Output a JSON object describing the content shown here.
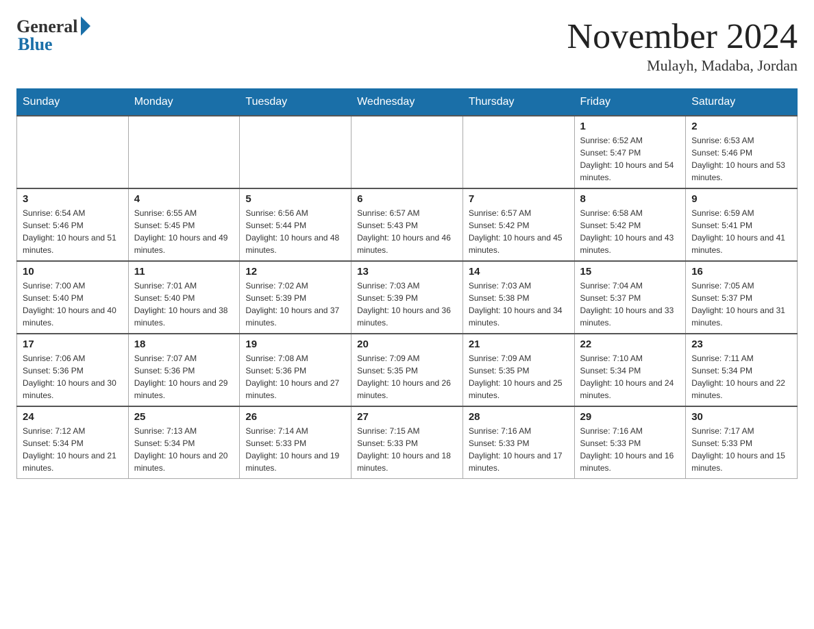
{
  "header": {
    "logo_general": "General",
    "logo_blue": "Blue",
    "month_title": "November 2024",
    "location": "Mulayh, Madaba, Jordan"
  },
  "days_of_week": [
    "Sunday",
    "Monday",
    "Tuesday",
    "Wednesday",
    "Thursday",
    "Friday",
    "Saturday"
  ],
  "weeks": [
    [
      {
        "day": "",
        "info": ""
      },
      {
        "day": "",
        "info": ""
      },
      {
        "day": "",
        "info": ""
      },
      {
        "day": "",
        "info": ""
      },
      {
        "day": "",
        "info": ""
      },
      {
        "day": "1",
        "info": "Sunrise: 6:52 AM\nSunset: 5:47 PM\nDaylight: 10 hours and 54 minutes."
      },
      {
        "day": "2",
        "info": "Sunrise: 6:53 AM\nSunset: 5:46 PM\nDaylight: 10 hours and 53 minutes."
      }
    ],
    [
      {
        "day": "3",
        "info": "Sunrise: 6:54 AM\nSunset: 5:46 PM\nDaylight: 10 hours and 51 minutes."
      },
      {
        "day": "4",
        "info": "Sunrise: 6:55 AM\nSunset: 5:45 PM\nDaylight: 10 hours and 49 minutes."
      },
      {
        "day": "5",
        "info": "Sunrise: 6:56 AM\nSunset: 5:44 PM\nDaylight: 10 hours and 48 minutes."
      },
      {
        "day": "6",
        "info": "Sunrise: 6:57 AM\nSunset: 5:43 PM\nDaylight: 10 hours and 46 minutes."
      },
      {
        "day": "7",
        "info": "Sunrise: 6:57 AM\nSunset: 5:42 PM\nDaylight: 10 hours and 45 minutes."
      },
      {
        "day": "8",
        "info": "Sunrise: 6:58 AM\nSunset: 5:42 PM\nDaylight: 10 hours and 43 minutes."
      },
      {
        "day": "9",
        "info": "Sunrise: 6:59 AM\nSunset: 5:41 PM\nDaylight: 10 hours and 41 minutes."
      }
    ],
    [
      {
        "day": "10",
        "info": "Sunrise: 7:00 AM\nSunset: 5:40 PM\nDaylight: 10 hours and 40 minutes."
      },
      {
        "day": "11",
        "info": "Sunrise: 7:01 AM\nSunset: 5:40 PM\nDaylight: 10 hours and 38 minutes."
      },
      {
        "day": "12",
        "info": "Sunrise: 7:02 AM\nSunset: 5:39 PM\nDaylight: 10 hours and 37 minutes."
      },
      {
        "day": "13",
        "info": "Sunrise: 7:03 AM\nSunset: 5:39 PM\nDaylight: 10 hours and 36 minutes."
      },
      {
        "day": "14",
        "info": "Sunrise: 7:03 AM\nSunset: 5:38 PM\nDaylight: 10 hours and 34 minutes."
      },
      {
        "day": "15",
        "info": "Sunrise: 7:04 AM\nSunset: 5:37 PM\nDaylight: 10 hours and 33 minutes."
      },
      {
        "day": "16",
        "info": "Sunrise: 7:05 AM\nSunset: 5:37 PM\nDaylight: 10 hours and 31 minutes."
      }
    ],
    [
      {
        "day": "17",
        "info": "Sunrise: 7:06 AM\nSunset: 5:36 PM\nDaylight: 10 hours and 30 minutes."
      },
      {
        "day": "18",
        "info": "Sunrise: 7:07 AM\nSunset: 5:36 PM\nDaylight: 10 hours and 29 minutes."
      },
      {
        "day": "19",
        "info": "Sunrise: 7:08 AM\nSunset: 5:36 PM\nDaylight: 10 hours and 27 minutes."
      },
      {
        "day": "20",
        "info": "Sunrise: 7:09 AM\nSunset: 5:35 PM\nDaylight: 10 hours and 26 minutes."
      },
      {
        "day": "21",
        "info": "Sunrise: 7:09 AM\nSunset: 5:35 PM\nDaylight: 10 hours and 25 minutes."
      },
      {
        "day": "22",
        "info": "Sunrise: 7:10 AM\nSunset: 5:34 PM\nDaylight: 10 hours and 24 minutes."
      },
      {
        "day": "23",
        "info": "Sunrise: 7:11 AM\nSunset: 5:34 PM\nDaylight: 10 hours and 22 minutes."
      }
    ],
    [
      {
        "day": "24",
        "info": "Sunrise: 7:12 AM\nSunset: 5:34 PM\nDaylight: 10 hours and 21 minutes."
      },
      {
        "day": "25",
        "info": "Sunrise: 7:13 AM\nSunset: 5:34 PM\nDaylight: 10 hours and 20 minutes."
      },
      {
        "day": "26",
        "info": "Sunrise: 7:14 AM\nSunset: 5:33 PM\nDaylight: 10 hours and 19 minutes."
      },
      {
        "day": "27",
        "info": "Sunrise: 7:15 AM\nSunset: 5:33 PM\nDaylight: 10 hours and 18 minutes."
      },
      {
        "day": "28",
        "info": "Sunrise: 7:16 AM\nSunset: 5:33 PM\nDaylight: 10 hours and 17 minutes."
      },
      {
        "day": "29",
        "info": "Sunrise: 7:16 AM\nSunset: 5:33 PM\nDaylight: 10 hours and 16 minutes."
      },
      {
        "day": "30",
        "info": "Sunrise: 7:17 AM\nSunset: 5:33 PM\nDaylight: 10 hours and 15 minutes."
      }
    ]
  ]
}
